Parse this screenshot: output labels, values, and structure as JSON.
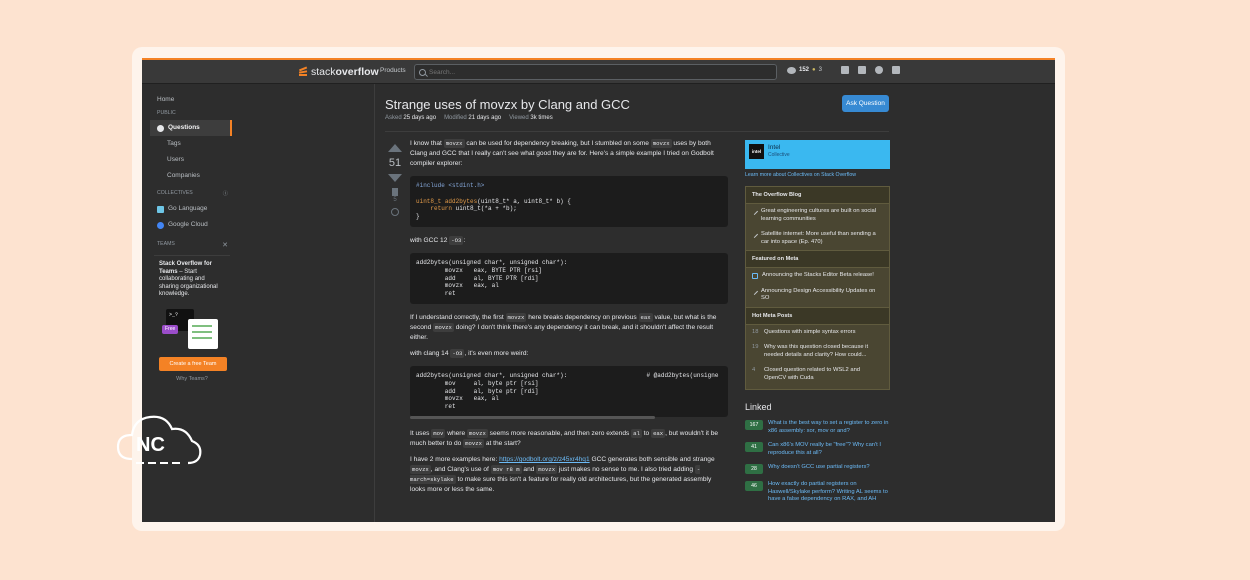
{
  "topbar": {
    "logo_light": "stack",
    "logo_bold": "overflow",
    "products": "Products",
    "search_placeholder": "Search...",
    "reputation": "152",
    "badge_count": "3"
  },
  "sidebar": {
    "home": "Home",
    "public_label": "PUBLIC",
    "questions": "Questions",
    "tags": "Tags",
    "users": "Users",
    "companies": "Companies",
    "collectives_label": "COLLECTIVES",
    "collectives": [
      "Go Language",
      "Google Cloud"
    ],
    "teams_label": "TEAMS",
    "teams_title": "Stack Overflow for Teams",
    "teams_text": "– Start collaborating and sharing organizational knowledge.",
    "illus_prompt": ">_?",
    "free_label": "Free",
    "create_team": "Create a free Team",
    "why_teams": "Why Teams?"
  },
  "question": {
    "title": "Strange uses of movzx by Clang and GCC",
    "asked_label": "Asked",
    "asked": "25 days ago",
    "modified_label": "Modified",
    "modified": "21 days ago",
    "viewed_label": "Viewed",
    "viewed": "3k times",
    "ask_button": "Ask Question",
    "votes": "51",
    "bookmarks": "5"
  },
  "post": {
    "p1_a": "I know that",
    "code_movzx": "movzx",
    "p1_b": "can be used for dependency breaking, but I stumbled on some",
    "p1_c": "uses by both Clang and GCC that I really can't see what good they are for. Here's a simple example I tried on Godbolt compiler explorer:",
    "code1_include": "#include <stdint.h>",
    "code1_kw_type": "uint8_t",
    "code1_fn": "add2bytes",
    "code1_line1_rest": "(uint8_t* a, uint8_t* b) {",
    "code1_return": "return",
    "code1_line2_rest": "uint8_t(*a + *b);",
    "code1_close": "}",
    "with_gcc_a": "with GCC 12",
    "code_o3": "-O3",
    "with_gcc_b": ":",
    "asm_gcc": "add2bytes(unsigned char*, unsigned char*):\n        movzx   eax, BYTE PTR [rsi]\n        add     al, BYTE PTR [rdi]\n        movzx   eax, al\n        ret",
    "p2_a": "If I understand correctly, the first",
    "p2_b": "here breaks dependency on previous",
    "code_eax": "eax",
    "p2_c": "value, but what is the second",
    "p2_d": "doing? I don't think there's any dependency it can break, and it shouldn't affect the result either.",
    "with_clang_a": "with clang 14",
    "with_clang_b": ", it's even more weird:",
    "asm_clang": "add2bytes(unsigned char*, unsigned char*):                      # @add2bytes(unsigne\n        mov     al, byte ptr [rsi]\n        add     al, byte ptr [rdi]\n        movzx   eax, al\n        ret",
    "p3_a": "It uses",
    "code_mov": "mov",
    "p3_b": "where",
    "p3_c": "seems more reasonable, and then zero extends",
    "code_al": "al",
    "p3_d": "to",
    "p3_e": ", but wouldn't it be much better to do",
    "p3_f": "at the start?",
    "p4_a": "I have 2 more examples here:",
    "p4_link": "https://godbolt.org/z/z45xr4hq1",
    "p4_b": "GCC generates both sensible and strange",
    "p4_c": ", and Clang's use of",
    "code_movr8": "mov r8 m",
    "p4_d": "and",
    "p4_e": "just makes no sense to me. I also tried adding",
    "code_march": "-march=skylake",
    "p4_f": "to make sure this isn't a feature for really old architectures, but the generated assembly looks more or less the same."
  },
  "right": {
    "collective_logo": "intel",
    "collective_name": "Intel",
    "collective_sub": "Collective",
    "learn_more": "Learn more about Collectives on Stack Overflow",
    "blog_header": "The Overflow Blog",
    "blog_items": [
      "Great engineering cultures are built on social learning communities",
      "Satellite internet: More useful than sending a car into space (Ep. 470)"
    ],
    "meta_header": "Featured on Meta",
    "meta_items": [
      "Announcing the Stacks Editor Beta release!",
      "Announcing Design Accessibility Updates on SO"
    ],
    "hot_header": "Hot Meta Posts",
    "hot_items": [
      {
        "num": "18",
        "text": "Questions with simple syntax errors"
      },
      {
        "num": "19",
        "text": "Why was this question closed because it needed details and clarity? How could..."
      },
      {
        "num": "4",
        "text": "Closed question related to WSL2 and OpenCV with Cuda"
      }
    ],
    "linked_header": "Linked",
    "linked": [
      {
        "score": "167",
        "text": "What is the best way to set a register to zero in x86 assembly: xor, mov or and?"
      },
      {
        "score": "41",
        "text": "Can x86's MOV really be \"free\"? Why can't I reproduce this at all?"
      },
      {
        "score": "28",
        "text": "Why doesn't GCC use partial registers?"
      },
      {
        "score": "46",
        "text": "How exactly do partial registers on Haswell/Skylake perform? Writing AL seems to have a false dependency on RAX, and AH"
      }
    ]
  },
  "watermark": "NC",
  "colors": {
    "accent": "#f48225",
    "link": "#6cbbf7",
    "ask_button": "#378ad3",
    "collective": "#3ab8f0",
    "background": "#fde3d0"
  }
}
